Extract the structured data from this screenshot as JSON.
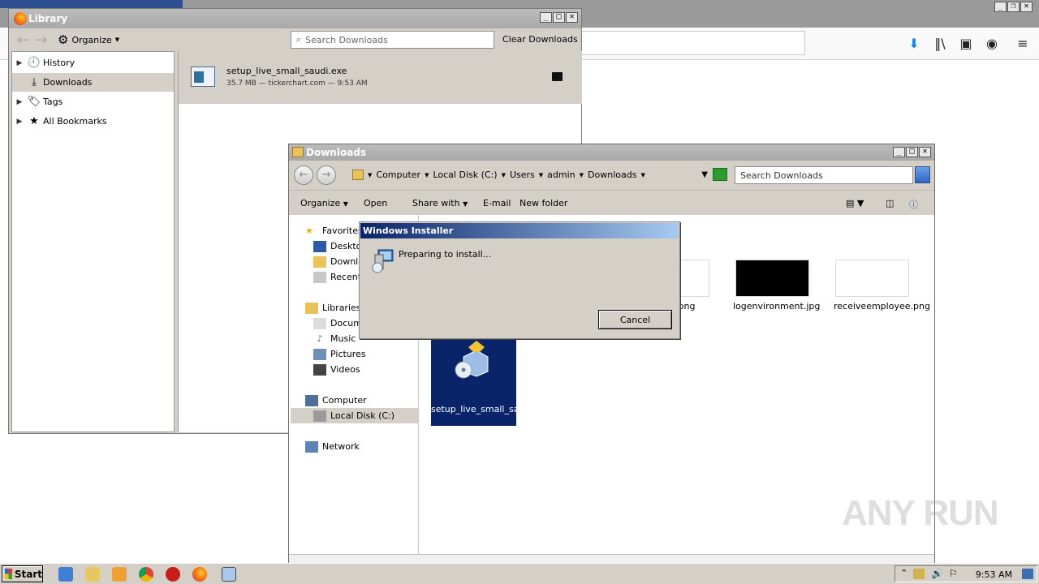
{
  "library": {
    "title": "Library",
    "organize_label": "Organize",
    "search_placeholder": "Search Downloads",
    "clear_label": "Clear Downloads",
    "sidebar": [
      {
        "label": "History",
        "icon": "clock-icon"
      },
      {
        "label": "Downloads",
        "icon": "download-icon"
      },
      {
        "label": "Tags",
        "icon": "tag-icon"
      },
      {
        "label": "All Bookmarks",
        "icon": "star-icon"
      }
    ],
    "download": {
      "name": "setup_live_small_saudi.exe",
      "meta": "35.7 MB — tickerchart.com — 9:53 AM"
    }
  },
  "explorer": {
    "title": "Downloads",
    "breadcrumb": [
      "Computer",
      "Local Disk (C:)",
      "Users",
      "admin",
      "Downloads"
    ],
    "search_placeholder": "Search Downloads",
    "commands": {
      "organize": "Organize",
      "open": "Open",
      "share": "Share with",
      "email": "E-mail",
      "new_folder": "New folder"
    },
    "nav": {
      "favorites": "Favorites",
      "desktop": "Deskto",
      "downloads": "Downlo",
      "recent": "Recent",
      "libraries": "Libraries",
      "documents": "Docum",
      "music": "Music",
      "pictures": "Pictures",
      "videos": "Videos",
      "computer": "Computer",
      "local_disk": "Local Disk (C:)",
      "network": "Network"
    },
    "files": {
      "file_png": ".png",
      "logenv": "logenvironment.jpg",
      "receive": "receiveemployee.png",
      "selected": "setup_live_small_saudi.exe"
    }
  },
  "installer": {
    "title": "Windows Installer",
    "message": "Preparing to install...",
    "cancel": "Cancel"
  },
  "taskbar": {
    "start": "Start",
    "clock": "9:53 AM"
  },
  "watermark": "ANY RUN"
}
